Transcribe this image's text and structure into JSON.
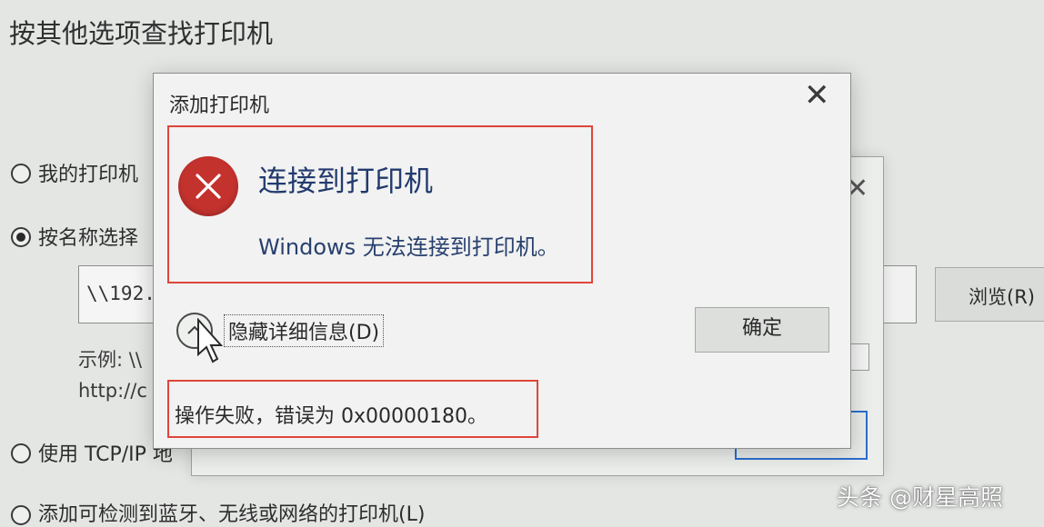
{
  "background_window": {
    "title": "按其他选项查找打印机",
    "options": [
      {
        "label": "我的打印机",
        "selected": false
      },
      {
        "label": "按名称选择",
        "selected": true
      },
      {
        "label": "使用 TCP/IP 地",
        "selected": false
      },
      {
        "label": "添加可检测到蓝牙、无线或网络的打印机(L)",
        "selected": false
      }
    ],
    "printer_name_value": "\\\\192.",
    "example_line1": "示例: \\\\",
    "example_line2": "http://c",
    "browse_label": "浏览(R)"
  },
  "dialog": {
    "title": "添加打印机",
    "heading": "连接到打印机",
    "message": "Windows 无法连接到打印机。",
    "toggle_details_label": "隐藏详细信息(D)",
    "ok_label": "确定",
    "details": "操作失败，错误为 0x00000180。",
    "icons": {
      "error": "error-x-icon",
      "close": "close-icon",
      "toggle": "chevron-up-icon"
    }
  },
  "colors": {
    "highlight": "#e0453a",
    "error_icon": "#c4322e",
    "heading_text": "#223a6e"
  },
  "watermark": "头条 @财星高照"
}
